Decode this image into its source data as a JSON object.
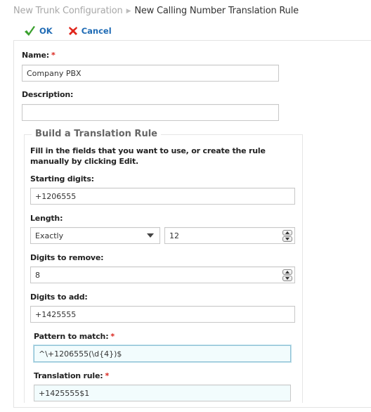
{
  "breadcrumb": {
    "parent": "New Trunk Configuration",
    "separator_icon": "triangle-right-icon",
    "current": "New Calling Number Translation Rule"
  },
  "toolbar": {
    "ok_label": "OK",
    "ok_icon": "checkmark-icon",
    "cancel_label": "Cancel",
    "cancel_icon": "x-icon"
  },
  "form": {
    "name": {
      "label": "Name:",
      "required_mark": "*",
      "value": "Company PBX"
    },
    "description": {
      "label": "Description:",
      "value": ""
    }
  },
  "builder": {
    "legend": "Build a Translation Rule",
    "instructions": "Fill in the fields that you want to use, or create the rule manually by clicking Edit.",
    "starting_digits": {
      "label": "Starting digits:",
      "value": "+1206555"
    },
    "length": {
      "label": "Length:",
      "mode_selected": "Exactly",
      "value": "12"
    },
    "digits_to_remove": {
      "label": "Digits to remove:",
      "value": "8"
    },
    "digits_to_add": {
      "label": "Digits to add:",
      "value": "+1425555"
    },
    "pattern_to_match": {
      "label": "Pattern to match:",
      "required_mark": "*",
      "value": "^\\+1206555(\\d{4})$"
    },
    "translation_rule": {
      "label": "Translation rule:",
      "required_mark": "*",
      "value": "+1425555$1"
    }
  },
  "colors": {
    "link_blue": "#1f6bb5",
    "required_red": "#d9251d",
    "ok_green": "#3aa02e",
    "cancel_red": "#e0261c",
    "readonly_tint": "#f2fcfd"
  }
}
